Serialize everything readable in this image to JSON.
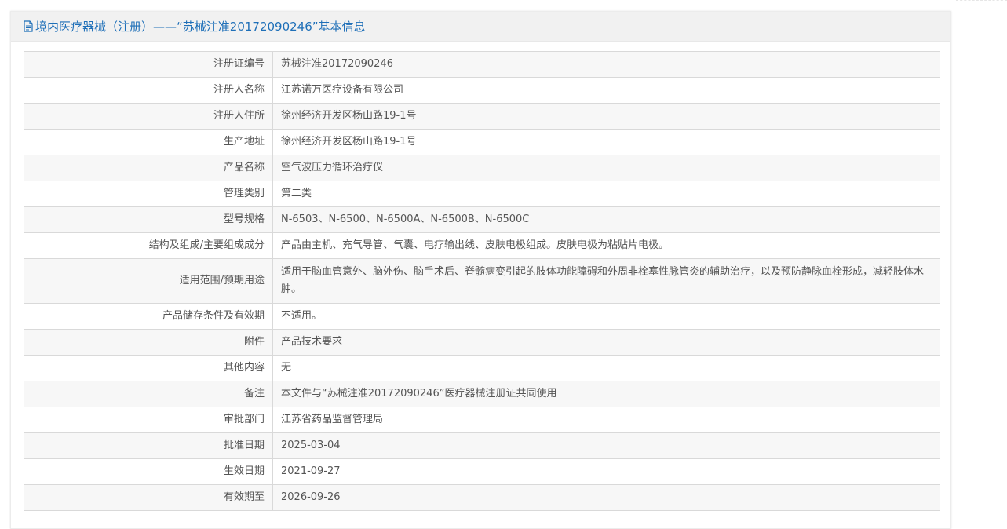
{
  "header": {
    "title": "境内医疗器械（注册）——“苏械注准20172090246”基本信息",
    "icon": "document-icon"
  },
  "colors": {
    "title_blue": "#1e6fb8",
    "header_bg": "#f1f1f1",
    "row_alt_bg": "#f7f7f7",
    "border": "#d9d9d9",
    "text": "#555555"
  },
  "rows": [
    {
      "label": "注册证编号",
      "value": "苏械注准20172090246"
    },
    {
      "label": "注册人名称",
      "value": "江苏诺万医疗设备有限公司"
    },
    {
      "label": "注册人住所",
      "value": "徐州经济开发区杨山路19-1号"
    },
    {
      "label": "生产地址",
      "value": "徐州经济开发区杨山路19-1号"
    },
    {
      "label": "产品名称",
      "value": "空气波压力循环治疗仪"
    },
    {
      "label": "管理类别",
      "value": "第二类"
    },
    {
      "label": "型号规格",
      "value": "N-6503、N-6500、N-6500A、N-6500B、N-6500C"
    },
    {
      "label": "结构及组成/主要组成成分",
      "value": "产品由主机、充气导管、气囊、电疗输出线、皮肤电极组成。皮肤电极为粘贴片电极。"
    },
    {
      "label": "适用范围/预期用途",
      "value": "适用于脑血管意外、脑外伤、脑手术后、脊髓病变引起的肢体功能障碍和外周非栓塞性脉管炎的辅助治疗，以及预防静脉血栓形成，减轻肢体水肿。"
    },
    {
      "label": "产品储存条件及有效期",
      "value": "不适用。"
    },
    {
      "label": "附件",
      "value": "产品技术要求"
    },
    {
      "label": "其他内容",
      "value": "无"
    },
    {
      "label": "备注",
      "value": "本文件与“苏械注准20172090246”医疗器械注册证共同使用"
    },
    {
      "label": "审批部门",
      "value": "江苏省药品监督管理局"
    },
    {
      "label": "批准日期",
      "value": "2025-03-04"
    },
    {
      "label": "生效日期",
      "value": "2021-09-27"
    },
    {
      "label": "有效期至",
      "value": "2026-09-26"
    }
  ]
}
